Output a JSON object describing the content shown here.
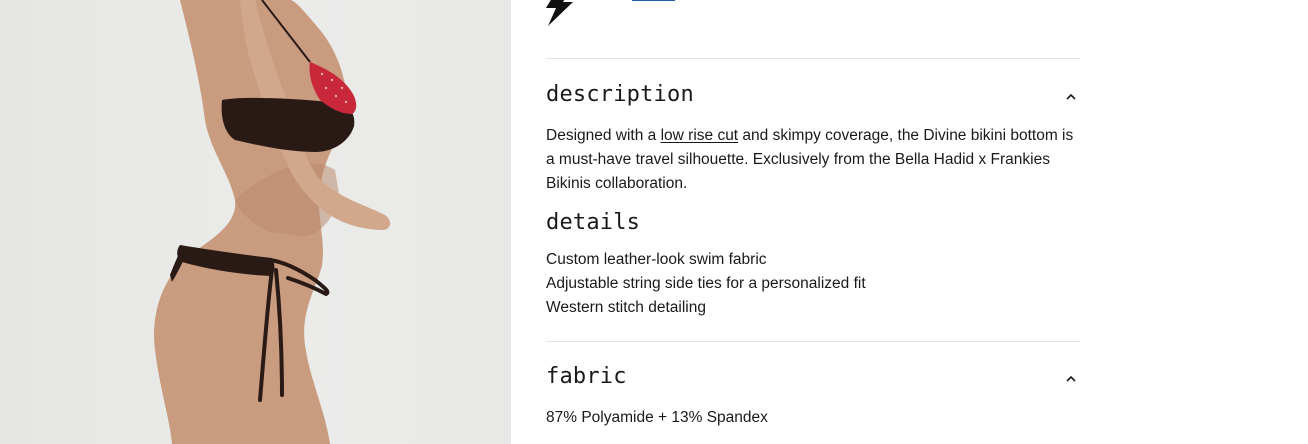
{
  "description": {
    "title": "description",
    "text_before": "Designed with a ",
    "link_text": "low rise cut",
    "text_after": " and skimpy coverage, the Divine bikini bottom is a must-have travel silhouette. Exclusively from the Bella Hadid x Frankies Bikinis collaboration.",
    "expanded_icon": "chevron-up-icon"
  },
  "details": {
    "title": "details",
    "items": [
      "Custom leather-look swim fabric",
      "Adjustable string side ties for a personalized fit",
      "Western stitch detailing"
    ]
  },
  "fabric": {
    "title": "fabric",
    "text": "87% Polyamide + 13% Spandex",
    "expanded_icon": "chevron-up-icon"
  },
  "icons": {
    "top": "lightning-bolt-icon"
  },
  "colors": {
    "link_underline": "#1f5fb0",
    "divider": "#e4e4e4",
    "bikini_main": "#2a1a16",
    "bikini_accent": "#c8283a"
  }
}
